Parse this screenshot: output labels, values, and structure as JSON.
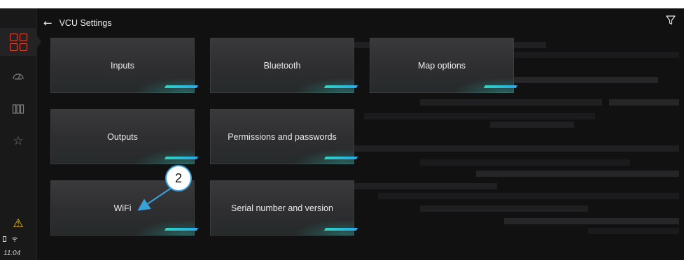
{
  "header": {
    "title": "VCU Settings"
  },
  "sidebar": {
    "items": [
      {
        "icon": "grid-icon",
        "active": true
      },
      {
        "icon": "gauge-icon",
        "active": false
      },
      {
        "icon": "columns-icon",
        "active": false
      },
      {
        "icon": "star-icon",
        "active": false
      }
    ],
    "warning_icon": "warning-icon",
    "status_icons": [
      "battery-icon",
      "wifi-icon"
    ],
    "time": "11:04"
  },
  "tiles": [
    {
      "label": "Inputs"
    },
    {
      "label": "Bluetooth"
    },
    {
      "label": "Map options"
    },
    {
      "label": "Outputs"
    },
    {
      "label": "Permissions and passwords"
    },
    {
      "label": "WiFi"
    },
    {
      "label": "Serial number and version"
    }
  ],
  "callout": {
    "number": "2"
  },
  "colors": {
    "accent_orange": "#e8503a",
    "accent_teal": "#2fd4c2",
    "warning_yellow": "#f2c318",
    "callout_blue": "#3aa0d8"
  }
}
